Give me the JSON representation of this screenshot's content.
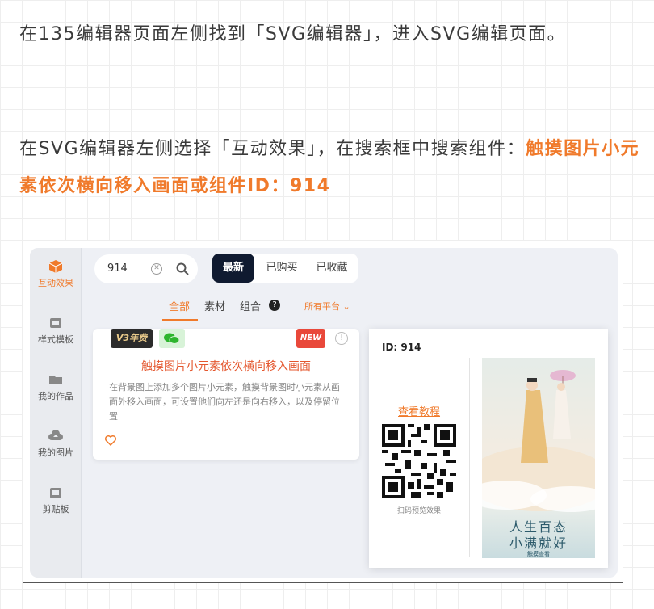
{
  "intro": {
    "paragraph1": "在135编辑器页面左侧找到「SVG编辑器」，进入SVG编辑页面。",
    "paragraph2_prefix": "在SVG编辑器左侧选择「互动效果」，在搜索框中搜索组件：",
    "paragraph2_highlight": "触摸图片小元素依次横向移入画面或组件ID：914"
  },
  "sidebar": {
    "items": [
      {
        "label": "互动效果",
        "icon": "cube-icon",
        "active": true
      },
      {
        "label": "样式模板",
        "icon": "template-icon",
        "active": false
      },
      {
        "label": "我的作品",
        "icon": "folder-icon",
        "active": false
      },
      {
        "label": "我的图片",
        "icon": "cloud-upload-icon",
        "active": false
      },
      {
        "label": "剪贴板",
        "icon": "clipboard-icon",
        "active": false
      }
    ]
  },
  "search": {
    "value": "914",
    "clear_icon": "clear-icon",
    "search_icon": "search-icon"
  },
  "filters": {
    "newest": "最新",
    "purchased": "已购买",
    "favorited": "已收藏"
  },
  "tabs": {
    "all": "全部",
    "material": "素材",
    "combo": "组合",
    "help": "?",
    "platform": "所有平台"
  },
  "card": {
    "badge_v3": "V3年费",
    "badge_new": "NEW",
    "info": "!",
    "title": "触摸图片小元素依次横向移入画面",
    "desc": "在背景图上添加多个图片小元素，触摸背景图时小元素从画面外移入画面，可设置他们向左还是向右移入，以及停留位置"
  },
  "popup": {
    "id_text": "ID: 914",
    "tutorial": "查看教程",
    "scan_text": "扫码预览效果",
    "poster_line1": "人生百态",
    "poster_line2": "小满就好",
    "poster_hint": "触摸查看"
  },
  "colors": {
    "accent": "#f07a2b",
    "dark": "#0f1a30",
    "title_red": "#e4572e"
  }
}
